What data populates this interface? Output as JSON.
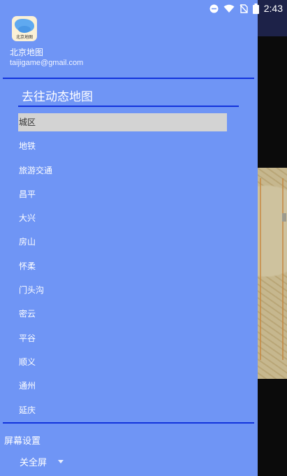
{
  "status_bar": {
    "time": "2:43"
  },
  "drawer": {
    "app_name": "北京地图",
    "email": "taijigame@gmail.com",
    "icon_text": "北京地图",
    "section_title": "去往动态地图",
    "items": [
      {
        "label": "城区",
        "selected": true
      },
      {
        "label": "地铁"
      },
      {
        "label": "旅游交通"
      },
      {
        "label": "昌平"
      },
      {
        "label": "大兴"
      },
      {
        "label": "房山"
      },
      {
        "label": "怀柔"
      },
      {
        "label": "门头沟"
      },
      {
        "label": "密云"
      },
      {
        "label": "平谷"
      },
      {
        "label": "顺义"
      },
      {
        "label": "通州"
      },
      {
        "label": "延庆"
      }
    ],
    "screen_settings_label": "屏幕设置",
    "screen_mode_value": "关全屏"
  },
  "colors": {
    "drawer_bg": "#6f95f5",
    "divider": "#1233dc",
    "selected_bg": "#d3d3d3",
    "topbar": "#1d2248"
  },
  "icons": [
    "minus-circle-icon",
    "wifi-icon",
    "no-sim-icon",
    "battery-icon",
    "chevron-down-icon"
  ]
}
